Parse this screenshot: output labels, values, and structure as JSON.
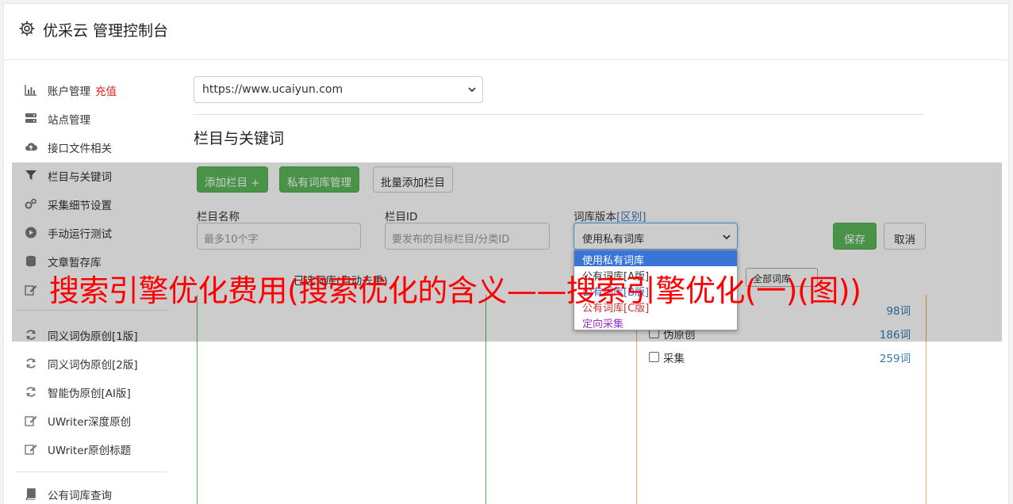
{
  "header": {
    "title": "优采云 管理控制台",
    "icon": "gear-icon"
  },
  "sidebar": {
    "items": [
      {
        "label": "账户管理",
        "extra": "充值",
        "icon": "bar-chart-icon"
      },
      {
        "label": "站点管理",
        "icon": "server-icon"
      },
      {
        "label": "接口文件相关",
        "icon": "cloud-upload-icon"
      },
      {
        "label": "栏目与关键词",
        "icon": "filter-icon",
        "active": true
      },
      {
        "label": "采集细节设置",
        "icon": "cogs-icon"
      },
      {
        "label": "手动运行测试",
        "icon": "play-circle-icon"
      },
      {
        "label": "文章暂存库",
        "icon": "database-icon"
      },
      {
        "label": "",
        "icon": "edit-icon"
      },
      {
        "label": "同义词伪原创[1版]",
        "icon": "refresh-icon"
      },
      {
        "label": "同义词伪原创[2版]",
        "icon": "refresh-icon"
      },
      {
        "label": "智能伪原创[AI版]",
        "icon": "refresh-icon"
      },
      {
        "label": "UWriter深度原创",
        "icon": "edit-icon"
      },
      {
        "label": "UWriter原创标题",
        "icon": "edit-icon"
      },
      {
        "label": "公有词库查询",
        "icon": "book-icon"
      }
    ]
  },
  "main": {
    "site_select": {
      "value": "https://www.ucaiyun.com"
    },
    "section_title": "栏目与关键词",
    "buttons": {
      "add_column": "添加栏目 +",
      "private_lib": "私有词库管理",
      "batch_add": "批量添加栏目",
      "save": "保存",
      "cancel": "取消"
    },
    "fields": {
      "column_name": {
        "label": "栏目名称",
        "placeholder": "最多10个字"
      },
      "column_id": {
        "label": "栏目ID",
        "placeholder": "要发布的目标栏目/分类ID"
      },
      "lib_version": {
        "label": "词库版本",
        "link": "[区别]",
        "value": "使用私有词库"
      }
    },
    "dropdown_options": [
      {
        "label": "使用私有词库",
        "color": "#ffffff",
        "selected": true
      },
      {
        "label": "公有词库[A版]",
        "color": "#333333"
      },
      {
        "label": "公有词库[B版]",
        "color": "#3366cc"
      },
      {
        "label": "公有词库[C版]",
        "color": "#cc3333"
      },
      {
        "label": "定向采集",
        "color": "#9933cc"
      }
    ],
    "selected_lib_label": "已选词库(自动去重)",
    "lib_filter": "全部词库",
    "lib_list": [
      {
        "name": "",
        "count": "98词"
      },
      {
        "name": "伪原创",
        "count": "186词"
      },
      {
        "name": "采集",
        "count": "259词"
      }
    ]
  },
  "headline": "搜索引擎优化费用(搜索优化的含义——搜索引擎优化(一)(图))",
  "colors": {
    "green": "#5cb85c",
    "orange": "#f0ad4e",
    "link": "#337ab7",
    "headline": "#ff0000",
    "highlight": "#3875d7"
  }
}
